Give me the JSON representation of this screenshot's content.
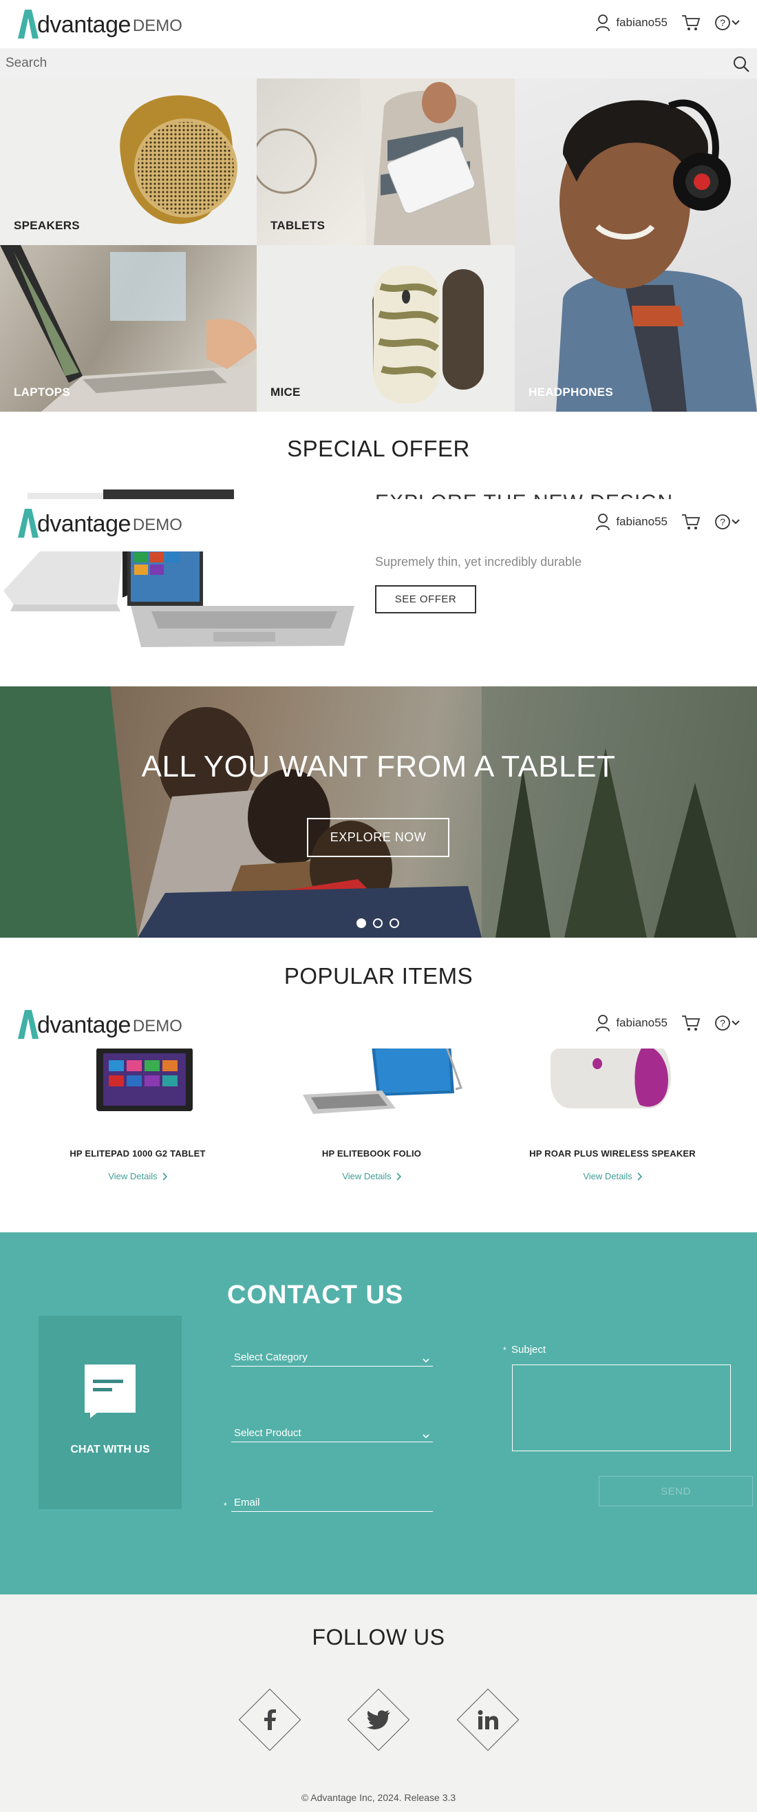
{
  "header": {
    "logo_word": "dvantage",
    "logo_demo": "DEMO",
    "username": "fabiano55",
    "icons": [
      "user-icon",
      "cart-icon",
      "help-icon",
      "chevron-down-icon"
    ]
  },
  "search": {
    "placeholder": "Search"
  },
  "categories": {
    "speakers": "SPEAKERS",
    "tablets": "TABLETS",
    "headphones": "HEADPHONES",
    "laptops": "LAPTOPS",
    "mice": "MICE"
  },
  "special_offer": {
    "title": "SPECIAL OFFER",
    "heading": "EXPLORE THE NEW DESIGN",
    "subtitle": "Supremely thin, yet incredibly durable",
    "button": "SEE OFFER"
  },
  "hero": {
    "title": "ALL YOU WANT FROM A TABLET",
    "button": "EXPLORE NOW",
    "slides": 3,
    "active_slide": 1
  },
  "popular": {
    "title": "POPULAR ITEMS",
    "items": [
      {
        "name": "HP ELITEPAD 1000 G2 TABLET",
        "link": "View Details"
      },
      {
        "name": "HP ELITEBOOK FOLIO",
        "link": "View Details"
      },
      {
        "name": "HP ROAR PLUS WIRELESS SPEAKER",
        "link": "View Details"
      }
    ]
  },
  "contact": {
    "title": "CONTACT US",
    "chat": "CHAT WITH US",
    "category_placeholder": "Select Category",
    "product_placeholder": "Select Product",
    "email_label": "Email",
    "subject_label": "Subject",
    "send": "SEND",
    "required_mark": "*"
  },
  "follow": {
    "title": "FOLLOW US",
    "networks": [
      "facebook-icon",
      "twitter-icon",
      "linkedin-icon"
    ]
  },
  "footer": {
    "copyright": "© Advantage Inc, 2024. Release 3.3"
  },
  "colors": {
    "teal": "#54b1a9",
    "teal_dark": "#48a39b",
    "logo_teal": "#3fb1a7"
  }
}
